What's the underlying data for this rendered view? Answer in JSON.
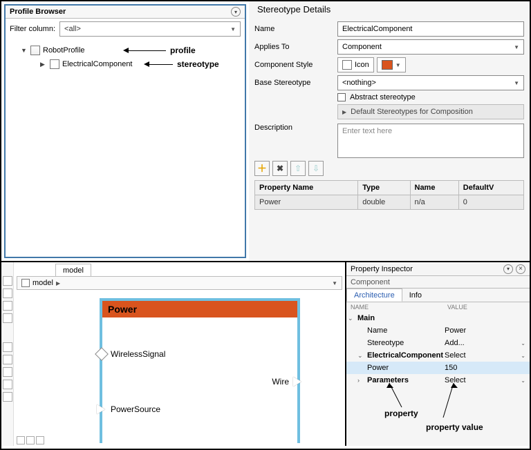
{
  "profileBrowser": {
    "title": "Profile Browser",
    "filterLabel": "Filter column:",
    "filterValue": "<all>",
    "tree": {
      "root": "RobotProfile",
      "child": "ElectricalComponent"
    },
    "annotations": {
      "profile": "profile",
      "stereotype": "stereotype"
    }
  },
  "details": {
    "title": "Stereotype Details",
    "nameLabel": "Name",
    "nameValue": "ElectricalComponent",
    "appliesLabel": "Applies To",
    "appliesValue": "Component",
    "styleLabel": "Component Style",
    "styleIcon": "Icon",
    "baseLabel": "Base Stereotype",
    "baseValue": "<nothing>",
    "abstractLabel": "Abstract stereotype",
    "collapse": "Default Stereotypes for Composition",
    "descLabel": "Description",
    "descPlaceholder": "Enter text here",
    "table": {
      "headers": [
        "Property Name",
        "Type",
        "Name",
        "DefaultV"
      ],
      "row": [
        "Power",
        "double",
        "n/a",
        "0"
      ]
    }
  },
  "canvas": {
    "tab": "model",
    "crumb": "model",
    "blockTitle": "Power",
    "ports": {
      "ws": "WirelessSignal",
      "wire": "Wire",
      "ps": "PowerSource"
    }
  },
  "inspector": {
    "title": "Property Inspector",
    "subtitle": "Component",
    "tabs": {
      "arch": "Architecture",
      "info": "Info"
    },
    "cols": {
      "name": "NAME",
      "value": "VALUE"
    },
    "rows": {
      "main": "Main",
      "name_k": "Name",
      "name_v": "Power",
      "stereo_k": "Stereotype",
      "stereo_v": "Add...",
      "elec": "ElectricalComponent",
      "elec_v": "Select",
      "pow_k": "Power",
      "pow_v": "150",
      "param": "Parameters",
      "param_v": "Select"
    },
    "annot": {
      "prop": "property",
      "propval": "property value"
    }
  }
}
